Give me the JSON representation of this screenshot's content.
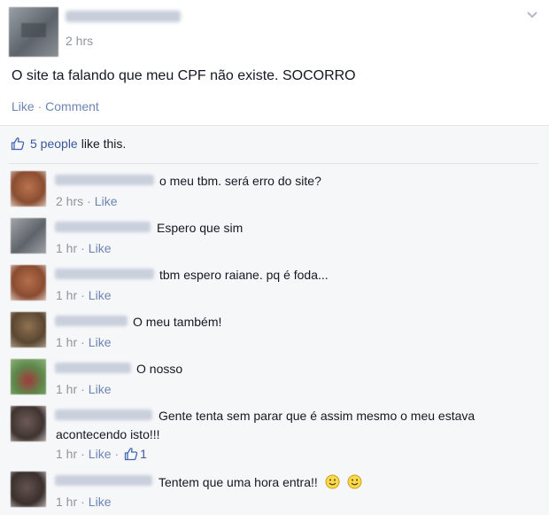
{
  "post": {
    "time": "2 hrs",
    "text": "O site ta falando que meu CPF não existe. SOCORRO",
    "actions": {
      "like": "Like",
      "separator": "·",
      "comment": "Comment"
    },
    "options_icon": "chevron-down-icon"
  },
  "likes": {
    "icon": "thumbs-up-icon",
    "count": "5 people",
    "rest": "like this."
  },
  "comments": [
    {
      "text": "o meu tbm. será erro do site?",
      "time": "2 hrs",
      "like": "Like"
    },
    {
      "text": "Espero que sim",
      "time": "1 hr",
      "like": "Like"
    },
    {
      "text": "tbm espero raiane. pq é foda...",
      "time": "1 hr",
      "like": "Like"
    },
    {
      "text": "O meu também!",
      "time": "1 hr",
      "like": "Like"
    },
    {
      "text": "O nosso",
      "time": "1 hr",
      "like": "Like"
    },
    {
      "text_line1": "Gente tenta sem parar que é assim mesmo o meu estava",
      "text_line2": "acontecendo isto!!!",
      "time": "1 hr",
      "like": "Like",
      "like_count": "1"
    },
    {
      "text": "Tentem que uma hora entra!!",
      "time": "1 hr",
      "like": "Like",
      "emoji": "smiley-icon"
    }
  ],
  "colors": {
    "link": "#3b5998",
    "meta": "#90949c",
    "action": "#6d84b4",
    "background": "#f6f7f9"
  }
}
